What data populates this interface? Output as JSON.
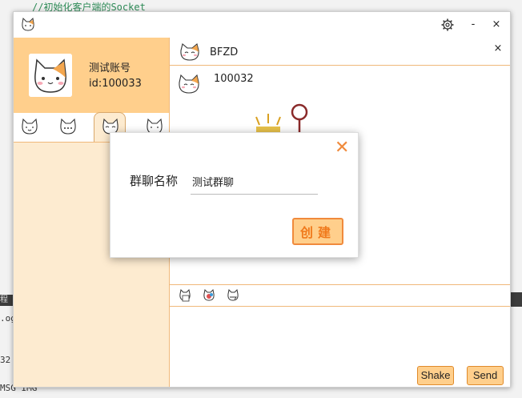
{
  "background": {
    "code_top": "//初始化客户端的Socket",
    "side_label": "程序",
    "line_og": ".og",
    "line_32": "32",
    "line_msg": "MSG IMG"
  },
  "profile": {
    "name": "测试账号",
    "id": "id:100033"
  },
  "chat": {
    "contact_name": "BFZD",
    "message_sender": "100032",
    "close_symbol": "×",
    "shake_label": "Shake",
    "send_label": "Send"
  },
  "titlebar": {
    "minimize_symbol": "-",
    "close_symbol": "×"
  },
  "dialog": {
    "close_symbol": "✕",
    "label": "群聊名称",
    "group_name_value": "测试群聊",
    "create_label": "创建"
  },
  "colors": {
    "accent": "#ffcf8c",
    "accent_border": "#f08a3c",
    "sidebar_bg": "#fdebd0"
  }
}
